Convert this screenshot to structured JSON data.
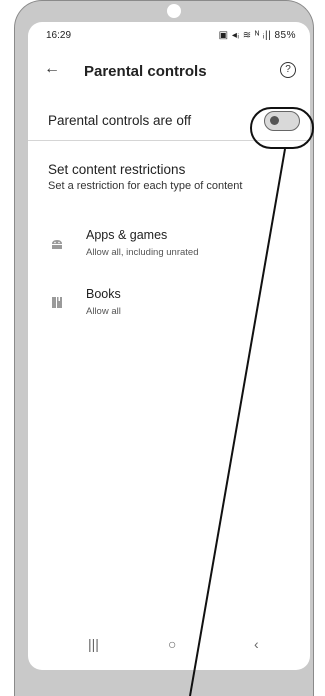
{
  "status_bar": {
    "time": "16:29",
    "icons": "▣ ◂ᵢ ≋ ᴺ ᵢ|| 85%",
    "battery": "85%"
  },
  "app_bar": {
    "title": "Parental controls"
  },
  "master": {
    "label": "Parental controls are off",
    "enabled": false
  },
  "section": {
    "title": "Set content restrictions",
    "subtitle": "Set a restriction for each type of content"
  },
  "items": [
    {
      "label": "Apps & games",
      "sub": "Allow all, including unrated",
      "icon": "android-icon"
    },
    {
      "label": "Books",
      "sub": "Allow all",
      "icon": "book-icon"
    }
  ],
  "nav": {
    "recents": "|||",
    "home": "○",
    "back": "‹"
  }
}
